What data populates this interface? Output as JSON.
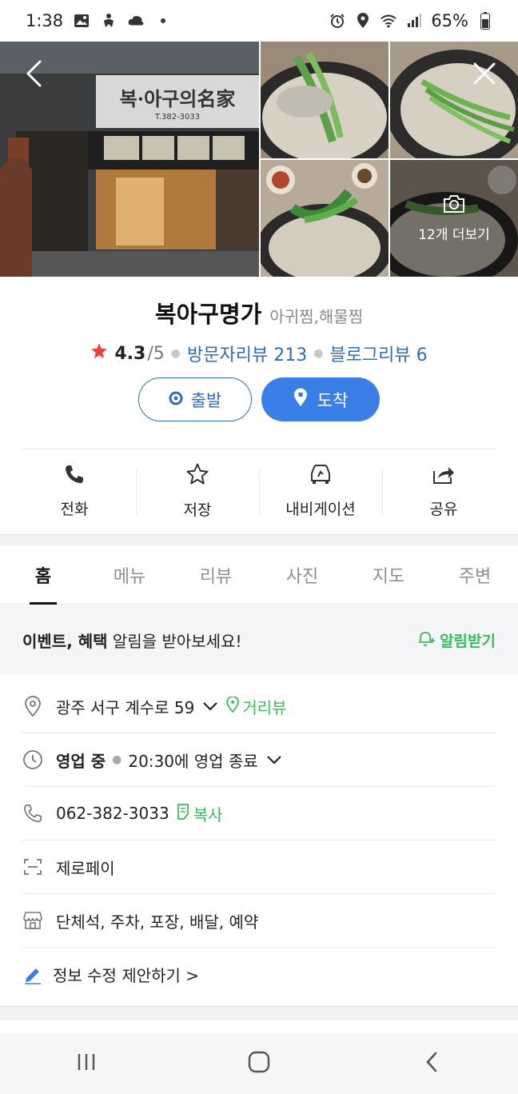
{
  "status": {
    "time": "1:38",
    "battery": "65%"
  },
  "gallery": {
    "storefront_sign": "복·아구의名家",
    "storefront_phone": "T.382-3033",
    "more_photos_label": "12개 더보기"
  },
  "place": {
    "name": "복아구명가",
    "category": "아귀찜,해물찜",
    "rating": "4.3",
    "rating_max": "/5",
    "visitor_reviews": "방문자리뷰 213",
    "blog_reviews": "블로그리뷰 6"
  },
  "route": {
    "start_label": "출발",
    "arrive_label": "도착"
  },
  "actions": [
    {
      "label": "전화",
      "icon": "phone-icon"
    },
    {
      "label": "저장",
      "icon": "star-icon"
    },
    {
      "label": "내비게이션",
      "icon": "car-icon"
    },
    {
      "label": "공유",
      "icon": "share-icon"
    }
  ],
  "tabs": [
    {
      "label": "홈",
      "active": true
    },
    {
      "label": "메뉴",
      "active": false
    },
    {
      "label": "리뷰",
      "active": false
    },
    {
      "label": "사진",
      "active": false
    },
    {
      "label": "지도",
      "active": false
    },
    {
      "label": "주변",
      "active": false
    }
  ],
  "event": {
    "bold_text": "이벤트, 혜택",
    "text": " 알림을 받아보세요!",
    "button_label": "알림받기"
  },
  "info": {
    "address": "광주 서구 계수로 59",
    "street_view": "거리뷰",
    "open_status": "영업 중",
    "close_time": "20:30에 영업 종료",
    "phone": "062-382-3033",
    "copy_label": "복사",
    "payment": "제로페이",
    "facilities": "단체석, 주차, 포장, 배달, 예약",
    "suggest_edit": "정보 수정 제안하기 >"
  },
  "colors": {
    "accent_blue": "#3a7fe8",
    "link_blue": "#2f6db5",
    "green": "#3bbd5c",
    "star_red": "#e8413e"
  }
}
